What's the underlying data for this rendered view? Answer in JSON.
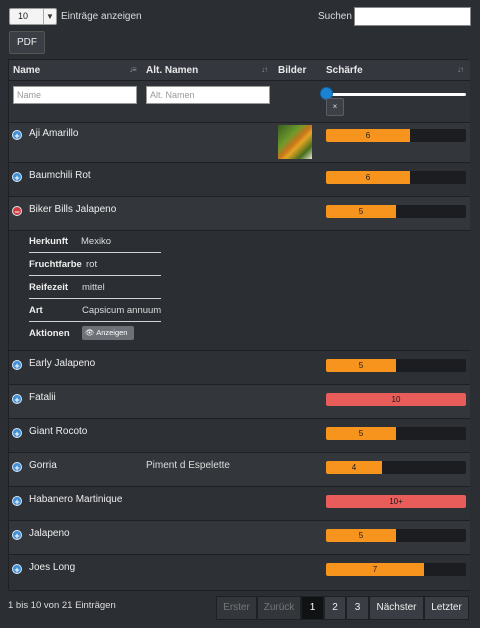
{
  "length_select": {
    "value": "10"
  },
  "length_label": "Einträge anzeigen",
  "search": {
    "label": "Suchen",
    "value": ""
  },
  "pdf_button": "PDF",
  "columns": {
    "name": "Name",
    "alt": "Alt. Namen",
    "images": "Bilder",
    "heat": "Schärfe"
  },
  "filters": {
    "name_placeholder": "Name",
    "alt_placeholder": "Alt. Namen",
    "reset": "×"
  },
  "rows": [
    {
      "name": "Aji Amarillo",
      "alt": "",
      "heat_label": "6",
      "heat_value": 6,
      "has_image": true,
      "expanded": false
    },
    {
      "name": "Baumchili Rot",
      "alt": "",
      "heat_label": "6",
      "heat_value": 6,
      "has_image": false,
      "expanded": false
    },
    {
      "name": "Biker Bills Jalapeno",
      "alt": "",
      "heat_label": "5",
      "heat_value": 5,
      "has_image": false,
      "expanded": true
    },
    {
      "name": "Early Jalapeno",
      "alt": "",
      "heat_label": "5",
      "heat_value": 5,
      "has_image": false,
      "expanded": false
    },
    {
      "name": "Fatalii",
      "alt": "",
      "heat_label": "10",
      "heat_value": 10,
      "has_image": false,
      "expanded": false
    },
    {
      "name": "Giant Rocoto",
      "alt": "",
      "heat_label": "5",
      "heat_value": 5,
      "has_image": false,
      "expanded": false
    },
    {
      "name": "Gorria",
      "alt": "Piment d Espelette",
      "heat_label": "4",
      "heat_value": 4,
      "has_image": false,
      "expanded": false
    },
    {
      "name": "Habanero Martinique",
      "alt": "",
      "heat_label": "10+",
      "heat_value": 10,
      "has_image": false,
      "expanded": false
    },
    {
      "name": "Jalapeno",
      "alt": "",
      "heat_label": "5",
      "heat_value": 5,
      "has_image": false,
      "expanded": false
    },
    {
      "name": "Joes Long",
      "alt": "",
      "heat_label": "7",
      "heat_value": 7,
      "has_image": false,
      "expanded": false
    }
  ],
  "detail": {
    "origin_label": "Herkunft",
    "origin": "Mexiko",
    "color_label": "Fruchtfarbe",
    "color": "rot",
    "ripe_label": "Reifezeit",
    "ripe": "mittel",
    "species_label": "Art",
    "species": "Capsicum annuum",
    "actions_label": "Aktionen",
    "show_button": "Anzeigen"
  },
  "info": "1 bis 10 von 21 Einträgen",
  "pagination": {
    "first": "Erster",
    "prev": "Zurück",
    "pages": [
      "1",
      "2",
      "3"
    ],
    "next": "Nächster",
    "last": "Letzter",
    "current_page": "1"
  },
  "colors": {
    "heat_normal": "#f7941e",
    "heat_hot": "#e85d59",
    "slider": "#1b83d4",
    "expand": "#3f8fd6",
    "collapse": "#d23c3c"
  }
}
